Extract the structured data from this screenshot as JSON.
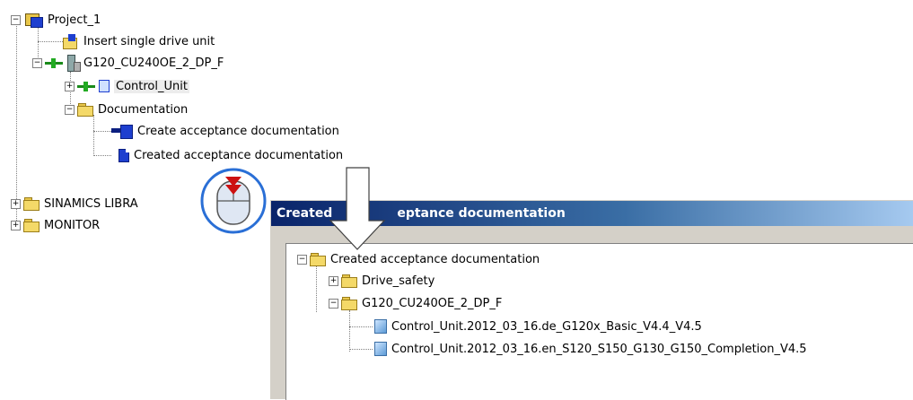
{
  "project_tree": {
    "root": "Project_1",
    "insert_item": "Insert single drive unit",
    "drive": "G120_CU240OE_2_DP_F",
    "control_unit": "Control_Unit",
    "documentation": "Documentation",
    "create_doc": "Create acceptance documentation",
    "created_doc": "Created acceptance documentation",
    "sinamics": "SINAMICS LIBRA",
    "monitor": "MONITOR"
  },
  "dialog": {
    "title_a": "Created",
    "title_b": "eptance documentation",
    "tree": {
      "root": "Created acceptance documentation",
      "drive_safety": "Drive_safety",
      "drive": "G120_CU240OE_2_DP_F",
      "file1": "Control_Unit.2012_03_16.de_G120x_Basic_V4.4_V4.5",
      "file2": "Control_Unit.2012_03_16.en_S120_S150_G130_G150_Completion_V4.5"
    }
  },
  "colors": {
    "title_start": "#0a246a",
    "title_end": "#a6caf0",
    "doc_blue": "#1e3fcf",
    "mouse_red": "#cc1111",
    "cursor_blue": "#2a6fd6"
  },
  "icons": {
    "expanded": "⊟",
    "collapsed": "⊞",
    "minus": "−",
    "plus": "+"
  }
}
